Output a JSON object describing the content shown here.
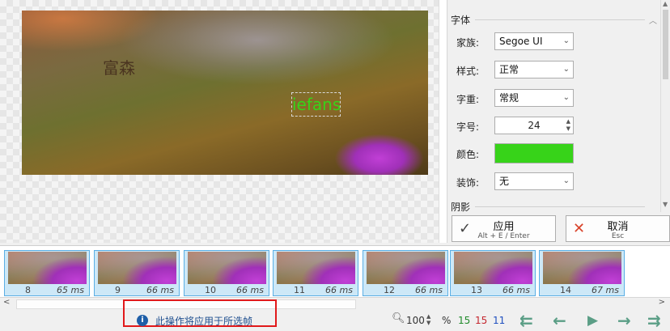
{
  "canvas": {
    "overlay_text_1": "富森",
    "overlay_text_2": "iefans"
  },
  "properties": {
    "font_section_title": "字体",
    "family_label": "家族:",
    "family_value": "Segoe UI",
    "style_label": "样式:",
    "style_value": "正常",
    "weight_label": "字重:",
    "weight_value": "常规",
    "size_label": "字号:",
    "size_value": "24",
    "color_label": "颜色:",
    "color_value": "#37d319",
    "decoration_label": "装饰:",
    "decoration_value": "无",
    "shadow_section_title": "阴影"
  },
  "actions": {
    "apply_label": "应用",
    "apply_shortcut": "Alt + E / Enter",
    "cancel_label": "取消",
    "cancel_shortcut": "Esc"
  },
  "frames": [
    {
      "num": "8",
      "ms": "65 ms"
    },
    {
      "num": "9",
      "ms": "66 ms"
    },
    {
      "num": "10",
      "ms": "66 ms"
    },
    {
      "num": "11",
      "ms": "66 ms"
    },
    {
      "num": "12",
      "ms": "66 ms"
    },
    {
      "num": "13",
      "ms": "66 ms"
    },
    {
      "num": "14",
      "ms": "67 ms"
    }
  ],
  "status": {
    "message": "此操作将应用于所选帧",
    "zoom_value": "100",
    "zoom_unit": "%",
    "count_green": "15",
    "count_red": "15",
    "count_blue": "11"
  },
  "icons": {
    "info": "info-icon",
    "magnifier": "magnifier-icon",
    "apply": "checkmark-icon",
    "cancel": "x-icon",
    "nav": [
      "first-frame-icon",
      "previous-frame-icon",
      "play-icon",
      "next-frame-icon",
      "last-frame-icon"
    ]
  },
  "colors": {
    "accent_selection": "#cde8f7",
    "selection_border": "#5aaee4",
    "cancel_icon": "#d9442c",
    "nav_icons": "#5b9e86",
    "message_border": "#e1191b"
  }
}
